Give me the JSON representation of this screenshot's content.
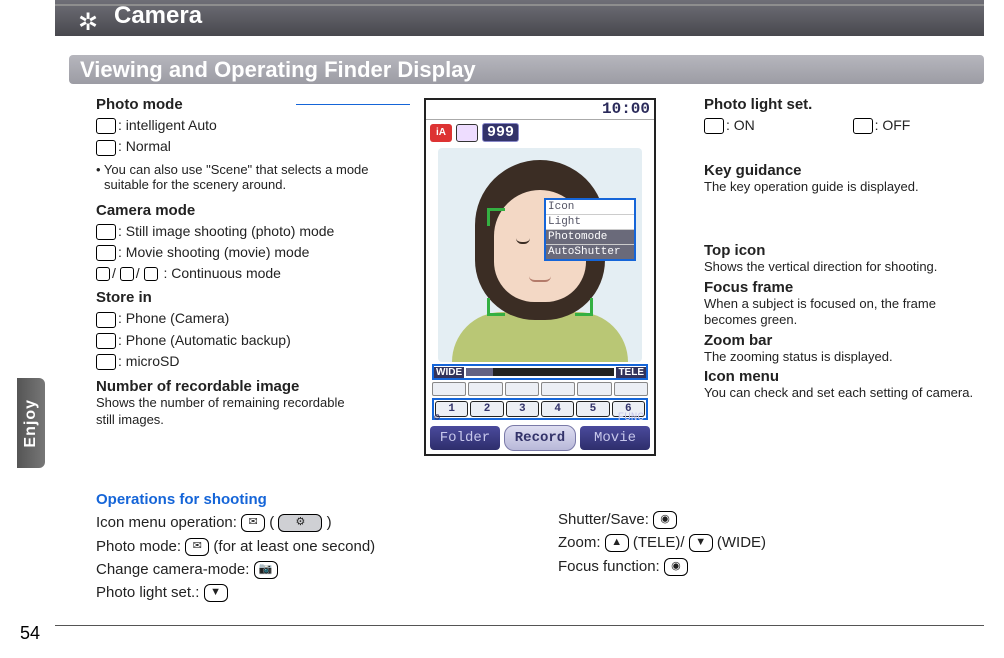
{
  "header": {
    "section": "Camera",
    "title": "Viewing and Operating Finder Display"
  },
  "left": {
    "photoMode": {
      "heading": "Photo mode",
      "items": [
        ": intelligent Auto",
        ": Normal"
      ],
      "note": "• You can also use \"Scene\" that selects a mode suitable for the scenery around."
    },
    "cameraMode": {
      "heading": "Camera mode",
      "items": [
        ": Still image shooting (photo) mode",
        ": Movie shooting (movie) mode",
        ": Continuous mode"
      ],
      "slashSep": "/"
    },
    "storeIn": {
      "heading": "Store in",
      "items": [
        ": Phone (Camera)",
        ": Phone (Automatic backup)",
        ": microSD"
      ]
    },
    "recordable": {
      "heading": "Number of recordable image",
      "desc": "Shows the number of remaining recordable still images."
    }
  },
  "right": {
    "photoLight": {
      "heading": "Photo light set.",
      "on": ": ON",
      "off": ": OFF"
    },
    "keyGuidance": {
      "heading": "Key guidance",
      "desc": "The key operation guide is displayed."
    },
    "topIcon": {
      "heading": "Top icon",
      "desc": "Shows the vertical direction for shooting."
    },
    "focusFrame": {
      "heading": "Focus frame",
      "desc": "When a subject is focused on, the frame becomes green."
    },
    "zoomBar": {
      "heading": "Zoom bar",
      "desc": "The zooming status is displayed."
    },
    "iconMenu": {
      "heading": "Icon menu",
      "desc": "You can check and set each setting of camera."
    }
  },
  "phone": {
    "time": "10:00",
    "badge": "iA",
    "counter": "999",
    "keyGuide": [
      "Icon",
      "Light",
      "Photomode",
      "AutoShutter"
    ],
    "zoomWide": "WIDE",
    "zoomTele": "TELE",
    "iconMenu": [
      "1",
      "2",
      "3",
      "4",
      "5",
      "6"
    ],
    "softLeftTiny": "⚙",
    "softLeft": "Folder",
    "softMid": "Record",
    "softRightTop": "FUNC",
    "softRight": "Movie"
  },
  "ops": {
    "heading": "Operations for shooting",
    "leftLines": {
      "l1a": "Icon menu operation: ",
      "l1b": " ( ",
      "l1c": " )",
      "l2a": "Photo mode: ",
      "l2b": "(for at least one second)",
      "l3a": "Change camera-mode: ",
      "l4a": "Photo light set.: "
    },
    "rightLines": {
      "r1a": "Shutter/Save: ",
      "r2a": "Zoom: ",
      "r2b": "(TELE)/",
      "r2c": "(WIDE)",
      "r3a": "Focus function: "
    }
  },
  "page": {
    "sideTab": "Enjoy",
    "number": "54"
  }
}
